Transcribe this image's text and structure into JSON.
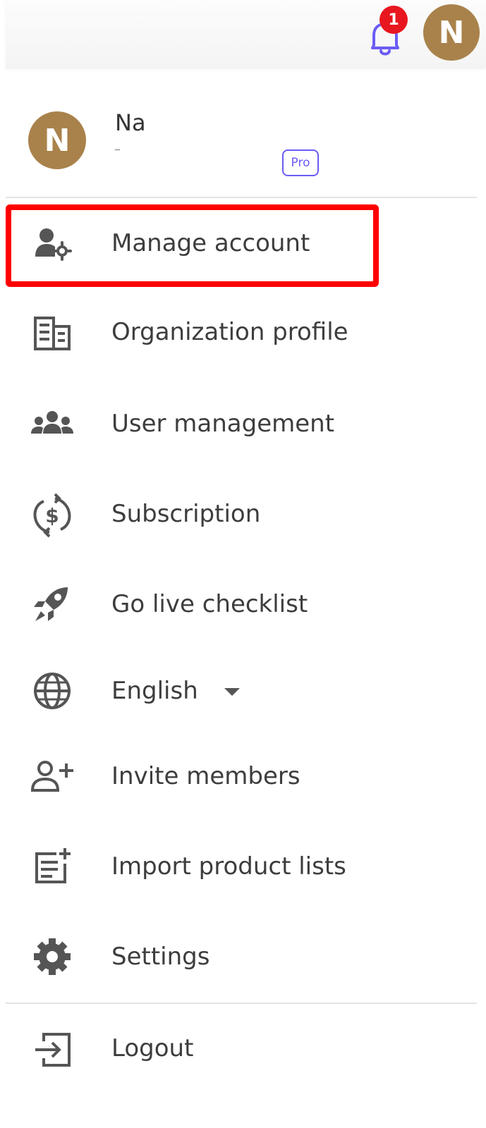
{
  "header": {
    "notification_count": "1",
    "avatar_initial": "N"
  },
  "profile": {
    "avatar_initial": "N",
    "name": "Na",
    "subtext": "‾",
    "plan_badge": "Pro"
  },
  "menu": {
    "items": [
      {
        "label": "Manage account",
        "icon": "user-gear-icon"
      },
      {
        "label": "Organization profile",
        "icon": "building-icon"
      },
      {
        "label": "User management",
        "icon": "users-group-icon"
      },
      {
        "label": "Subscription",
        "icon": "dollar-cycle-icon"
      },
      {
        "label": "Go live checklist",
        "icon": "rocket-icon"
      },
      {
        "label": "English",
        "icon": "globe-icon"
      },
      {
        "label": "Invite members",
        "icon": "user-plus-icon"
      },
      {
        "label": "Import product lists",
        "icon": "list-add-icon"
      },
      {
        "label": "Settings",
        "icon": "gear-icon"
      },
      {
        "label": "Logout",
        "icon": "logout-icon"
      }
    ]
  },
  "colors": {
    "accent": "#6b5cf5",
    "avatar": "#a9824b",
    "badge": "#e8171f",
    "highlight": "#ff0000",
    "icon": "#555555"
  }
}
